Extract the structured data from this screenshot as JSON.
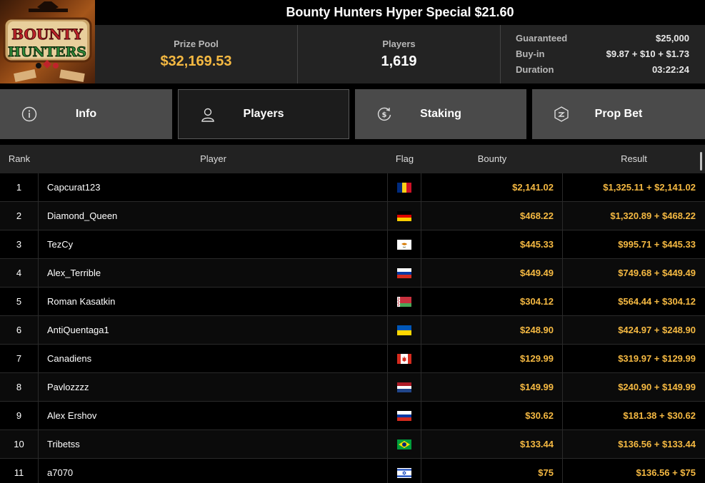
{
  "logo": {
    "line1": "BOUNTY",
    "line2": "HUNTERS"
  },
  "title": "Bounty Hunters Hyper Special $21.60",
  "stats": {
    "prize_pool_label": "Prize Pool",
    "prize_pool_value": "$32,169.53",
    "players_label": "Players",
    "players_value": "1,619",
    "details": [
      {
        "label": "Guaranteed",
        "value": "$25,000"
      },
      {
        "label": "Buy-in",
        "value": "$9.87 + $10 + $1.73"
      },
      {
        "label": "Duration",
        "value": "03:22:24"
      }
    ]
  },
  "tabs": [
    {
      "label": "Info",
      "icon": "info-icon",
      "active": false
    },
    {
      "label": "Players",
      "icon": "user-icon",
      "active": true
    },
    {
      "label": "Staking",
      "icon": "dollar-cycle-icon",
      "active": false
    },
    {
      "label": "Prop Bet",
      "icon": "prop-bet-icon",
      "active": false
    }
  ],
  "table": {
    "headers": {
      "rank": "Rank",
      "player": "Player",
      "flag": "Flag",
      "bounty": "Bounty",
      "result": "Result"
    },
    "rows": [
      {
        "rank": "1",
        "player": "Capcurat123",
        "flag": "romania",
        "bounty": "$2,141.02",
        "result": "$1,325.11 + $2,141.02"
      },
      {
        "rank": "2",
        "player": "Diamond_Queen",
        "flag": "germany",
        "bounty": "$468.22",
        "result": "$1,320.89 + $468.22"
      },
      {
        "rank": "3",
        "player": "TezCy",
        "flag": "cyprus",
        "bounty": "$445.33",
        "result": "$995.71 + $445.33"
      },
      {
        "rank": "4",
        "player": "Alex_Terrible",
        "flag": "russia",
        "bounty": "$449.49",
        "result": "$749.68 + $449.49"
      },
      {
        "rank": "5",
        "player": "Roman Kasatkin",
        "flag": "belarus",
        "bounty": "$304.12",
        "result": "$564.44 + $304.12"
      },
      {
        "rank": "6",
        "player": "AntiQuentaga1",
        "flag": "ukraine",
        "bounty": "$248.90",
        "result": "$424.97 + $248.90"
      },
      {
        "rank": "7",
        "player": "Canadiens",
        "flag": "canada",
        "bounty": "$129.99",
        "result": "$319.97 + $129.99"
      },
      {
        "rank": "8",
        "player": "Pavlozzzz",
        "flag": "netherlands",
        "bounty": "$149.99",
        "result": "$240.90 + $149.99"
      },
      {
        "rank": "9",
        "player": "Alex Ershov",
        "flag": "russia",
        "bounty": "$30.62",
        "result": "$181.38 + $30.62"
      },
      {
        "rank": "10",
        "player": "Tribetss",
        "flag": "brazil",
        "bounty": "$133.44",
        "result": "$136.56 + $133.44"
      },
      {
        "rank": "11",
        "player": "a7070",
        "flag": "israel",
        "bounty": "$75",
        "result": "$136.56 + $75"
      }
    ]
  },
  "colors": {
    "accent_gold": "#f5b942",
    "tab_bg": "#4a4a4a",
    "panel_bg": "#232323"
  }
}
